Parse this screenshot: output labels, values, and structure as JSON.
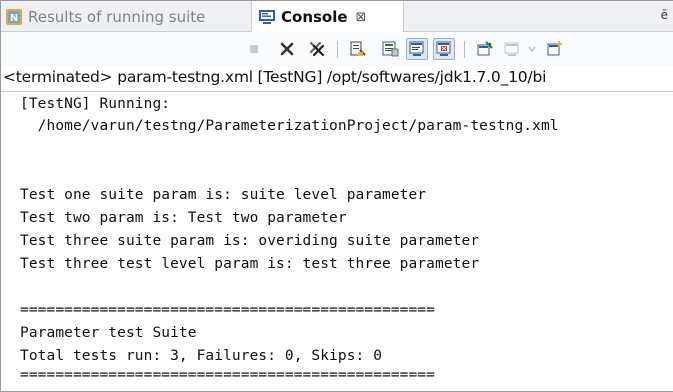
{
  "tabs": [
    {
      "label": "Results of running suite",
      "icon": "testng-results-icon"
    },
    {
      "label": "Console",
      "icon": "console-icon",
      "close": "⊠"
    }
  ],
  "tab_trail": "ē",
  "toolbar": {
    "buttons": [
      {
        "name": "terminate",
        "icon": "stop-icon"
      },
      {
        "name": "remove-launch",
        "icon": "remove-icon"
      },
      {
        "name": "remove-all-terminated",
        "icon": "remove-all-icon"
      },
      {
        "name": "clear-console",
        "icon": "clear-console-icon"
      },
      {
        "name": "scroll-lock",
        "icon": "scroll-lock-icon"
      },
      {
        "name": "show-console-stdout",
        "icon": "show-stdout-icon"
      },
      {
        "name": "show-console-stderr",
        "icon": "show-stderr-icon"
      },
      {
        "name": "pin-console",
        "icon": "pin-icon"
      },
      {
        "name": "display-selected-console",
        "icon": "display-console-icon"
      },
      {
        "name": "dropdown",
        "icon": "chevron-down-icon"
      },
      {
        "name": "open-console",
        "icon": "open-console-icon"
      }
    ]
  },
  "status": "<terminated> param-testng.xml [TestNG] /opt/softwares/jdk1.7.0_10/bi",
  "console": {
    "lines": [
      "[TestNG] Running:",
      "  /home/varun/testng/ParameterizationProject/param-testng.xml",
      "",
      "Test one suite param is: suite level parameter",
      "Test two param is: Test two parameter",
      "Test three suite param is: overiding suite parameter",
      "Test three test level param is: test three parameter",
      "",
      "===============================================",
      "Parameter test Suite",
      "Total tests run: 3, Failures: 0, Skips: 0",
      "==============================================="
    ]
  }
}
